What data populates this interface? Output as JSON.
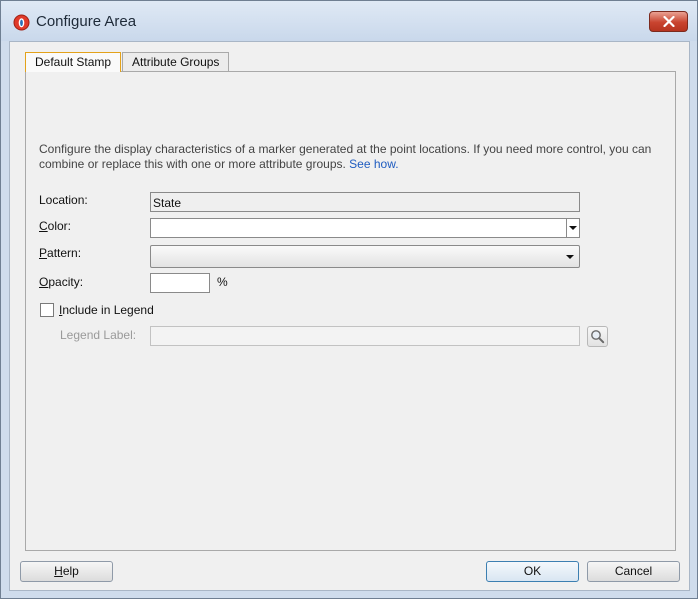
{
  "window": {
    "title": "Configure Area"
  },
  "tabs": [
    {
      "label": "Default Stamp",
      "active": true
    },
    {
      "label": "Attribute Groups",
      "active": false
    }
  ],
  "description": {
    "text": "Configure the display characteristics of a marker generated at the point locations. If you need more control, you can combine or replace this with one or more attribute groups.",
    "link": "See how."
  },
  "form": {
    "location": {
      "label": "Location:",
      "value": "State"
    },
    "color": {
      "label_mnemonic": "C",
      "label_rest": "olor:",
      "value": ""
    },
    "pattern": {
      "label_mnemonic": "P",
      "label_rest": "attern:",
      "value": ""
    },
    "opacity": {
      "label_mnemonic": "O",
      "label_rest": "pacity:",
      "value": "",
      "unit": "%"
    },
    "include_in_legend": {
      "label_mnemonic": "I",
      "label_rest": "nclude in Legend",
      "checked": false
    },
    "legend_label": {
      "label_pre": "Le",
      "label_mnemonic": "g",
      "label_rest": "end Label:",
      "value": ""
    }
  },
  "buttons": {
    "help_mnemonic": "H",
    "help_rest": "elp",
    "ok": "OK",
    "cancel": "Cancel"
  },
  "icons": {
    "app": "oracle-logo-icon",
    "close": "close-icon",
    "search": "search-icon",
    "dropdown": "chevron-down-icon"
  },
  "colors": {
    "tab_active_border": "#e3a21a",
    "link": "#1f5cc0",
    "close_button": "#c9442f"
  }
}
